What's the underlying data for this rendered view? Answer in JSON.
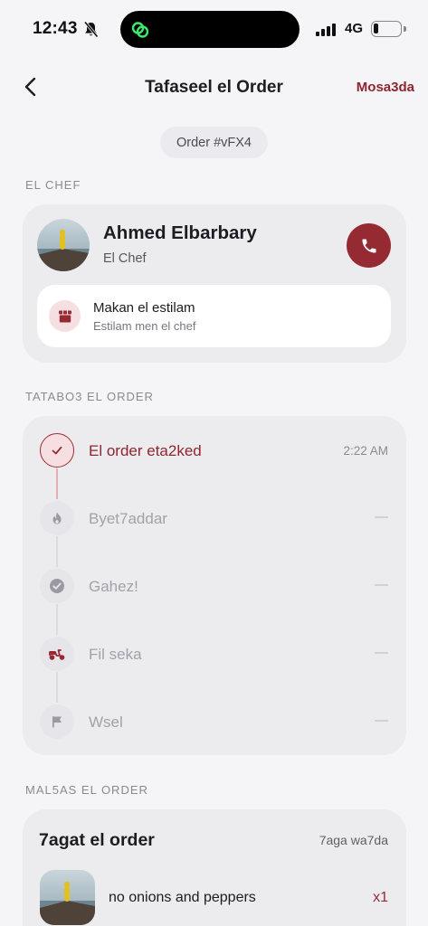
{
  "status_bar": {
    "time": "12:43",
    "network": "4G",
    "icons": [
      "bell-off-icon",
      "app-activity-icon",
      "signal-icon",
      "battery-icon"
    ]
  },
  "nav": {
    "title": "Tafaseel el Order",
    "help": "Mosa3da",
    "back_icon": "chevron-left-icon"
  },
  "order_chip": "Order #vFX4",
  "chef_section": {
    "label": "EL CHEF",
    "name": "Ahmed Elbarbary",
    "role": "El Chef",
    "call_icon": "phone-icon",
    "pickup": {
      "title": "Makan el estilam",
      "subtitle": "Estilam men el chef",
      "icon": "store-icon"
    }
  },
  "tracking": {
    "label": "TATABO3 EL ORDER",
    "steps": [
      {
        "label": "El order eta2ked",
        "time": "2:22 AM",
        "icon": "check-icon",
        "state": "done"
      },
      {
        "label": "Byet7addar",
        "time": "—",
        "icon": "flame-icon",
        "state": "pending"
      },
      {
        "label": "Gahez!",
        "time": "—",
        "icon": "check-circle-icon",
        "state": "pending"
      },
      {
        "label": "Fil seka",
        "time": "—",
        "icon": "scooter-icon",
        "state": "pending"
      },
      {
        "label": "Wsel",
        "time": "—",
        "icon": "flag-icon",
        "state": "pending"
      }
    ]
  },
  "summary": {
    "label": "MAL5AS EL ORDER",
    "title": "7agat el order",
    "count": "7aga wa7da",
    "items": [
      {
        "name": "no onions and peppers",
        "qty": "x1"
      }
    ]
  },
  "colors": {
    "accent": "#962a33",
    "background": "#f5f5f7",
    "card": "#ececef",
    "muted_text": "#8a8a93"
  }
}
